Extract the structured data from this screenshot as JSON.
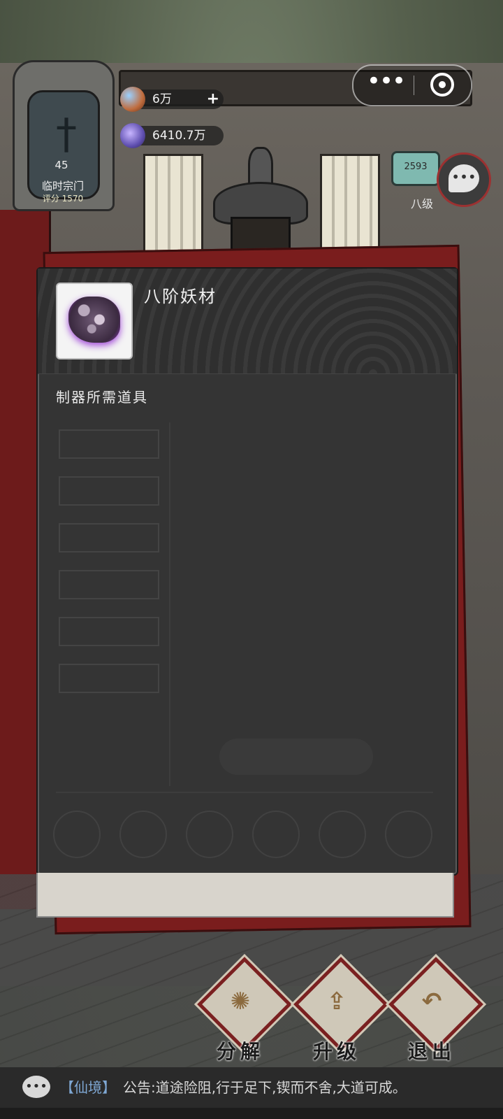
{
  "sect": {
    "level": "45",
    "name": "临时宗门",
    "score": "评分 1570"
  },
  "currencies": [
    {
      "value": "6万",
      "icon": "spirit-flower-icon"
    },
    {
      "value": "6410.7万",
      "icon": "spirit-crystal-icon"
    }
  ],
  "side": {
    "scroll_badge": "2593",
    "label": "八级"
  },
  "item": {
    "name": "八阶妖材",
    "icon": "ore-icon"
  },
  "dialog": {
    "section_label": "制器所需道具"
  },
  "actions": {
    "decompose": "分解",
    "upgrade": "升级",
    "exit": "退出"
  },
  "announcement": {
    "channel": "【仙境】",
    "text": "公告:道途险阻,行于足下,锲而不舍,大道可成。"
  },
  "colors": {
    "dialog_bg": "#343434",
    "accent_red": "#7a2020",
    "channel_blue": "#7fa8d4"
  }
}
